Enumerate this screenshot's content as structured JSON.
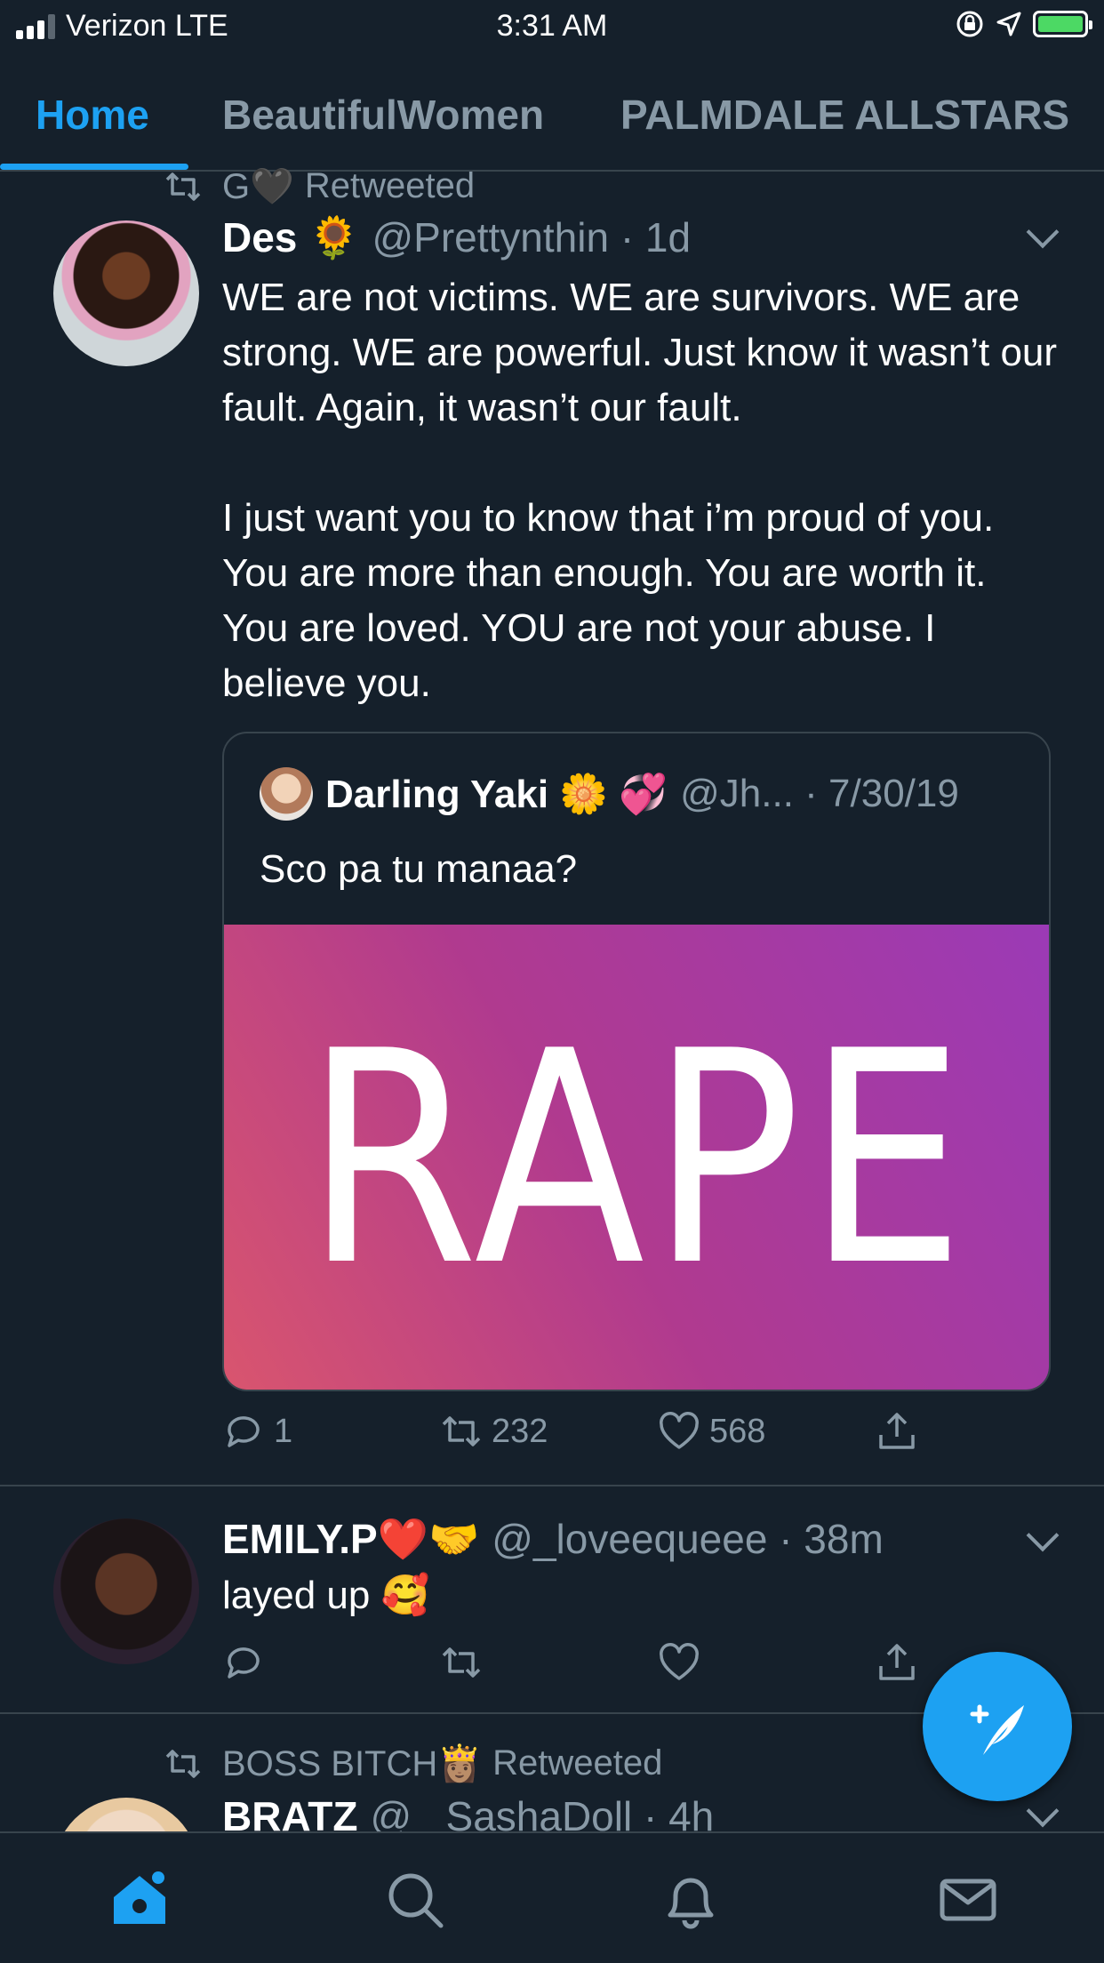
{
  "status_bar": {
    "carrier": "Verizon LTE",
    "time": "3:31 AM"
  },
  "tabs": [
    {
      "label": "Home",
      "active": true
    },
    {
      "label": "BeautifulWomen",
      "active": false
    },
    {
      "label": "PALMDALE ALLSTARS",
      "active": false
    }
  ],
  "tweets": [
    {
      "retweeted_by": "G🖤",
      "retweeted_label": "Retweeted",
      "name": "Des 🌻",
      "handle": "@Prettynthin · 1d",
      "text": "WE are not victims. WE are survivors. WE are strong. WE are powerful. Just know it wasn’t our fault. Again, it wasn’t our fault.\n\nI just want you to know that i’m proud of you. You are more than enough. You are worth it. You are loved. YOU are not your abuse. I believe you.",
      "quote": {
        "name": "Darling Yaki 🌼 💞",
        "handle": "@Jh... · 7/30/19",
        "text": "Sco pa tu manaa?",
        "image_text": "RAPE"
      },
      "counts": {
        "replies": "1",
        "retweets": "232",
        "likes": "568"
      }
    },
    {
      "name": "EMILY.P❤️🤝",
      "handle": "@_loveequeee · 38m",
      "text": "layed up 🥰"
    },
    {
      "retweeted_by": "BOSS BITCH👸🏽",
      "retweeted_label": "Retweeted",
      "name": "BRATZ",
      "handle": "@ _SashaDoll · 4h"
    }
  ],
  "colors": {
    "background": "#15202b",
    "accent": "#1da1f2",
    "secondary_text": "#8899a6",
    "divider": "#38444d"
  },
  "icons": [
    "signal-icon",
    "lock-rotation-icon",
    "location-icon",
    "battery-icon",
    "retweet-icon",
    "chevron-down-icon",
    "reply-icon",
    "like-icon",
    "share-icon",
    "compose-icon",
    "home-icon",
    "search-icon",
    "notifications-icon",
    "messages-icon"
  ]
}
